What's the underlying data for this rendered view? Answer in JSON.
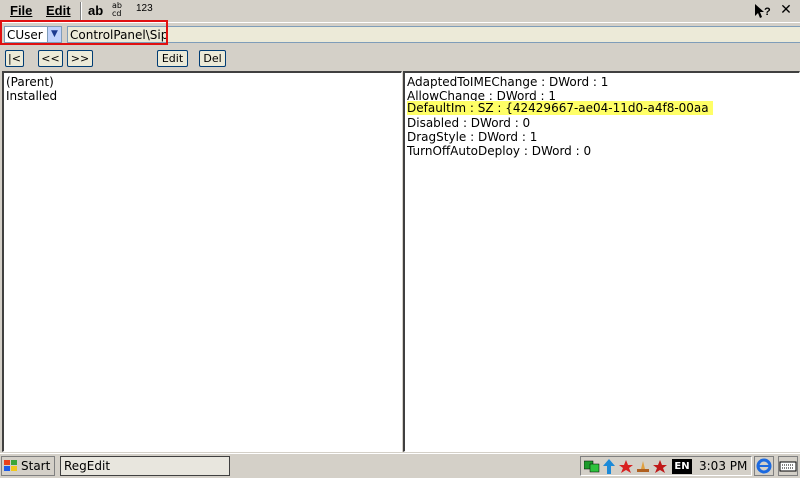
{
  "menubar": {
    "file_label": "File",
    "edit_label": "Edit",
    "toolbar": [
      {
        "name": "ab",
        "label": "ab"
      },
      {
        "name": "abc-def",
        "label": "ab\ncd"
      },
      {
        "name": "123",
        "label": "123"
      }
    ],
    "help_icon": "help-question-icon",
    "close_icon": "close-icon"
  },
  "address": {
    "root_value": "CUser",
    "path_value": "ControlPanel\\Sip"
  },
  "nav": {
    "first_label": "|<",
    "prev_label": "<<",
    "next_label": ">>",
    "edit_label": "Edit",
    "del_label": "Del"
  },
  "left_pane": {
    "items": [
      "(Parent)",
      "Installed"
    ]
  },
  "right_pane": {
    "values": [
      "AdaptedToIMEChange : DWord : 1",
      "AllowChange : DWord : 1",
      "DefaultIm : SZ : {42429667-ae04-11d0-a4f8-00aa",
      "Disabled : DWord : 0",
      "DragStyle : DWord : 1",
      "TurnOffAutoDeploy : DWord : 0"
    ],
    "highlighted_index": 2
  },
  "taskbar": {
    "start_label": "Start",
    "task_label": "RegEdit",
    "language_badge": "EN",
    "clock": "3:03 PM"
  },
  "colors": {
    "highlight": "#ffff66",
    "frame_red": "#e01010",
    "chrome": "#d4d0c8"
  }
}
